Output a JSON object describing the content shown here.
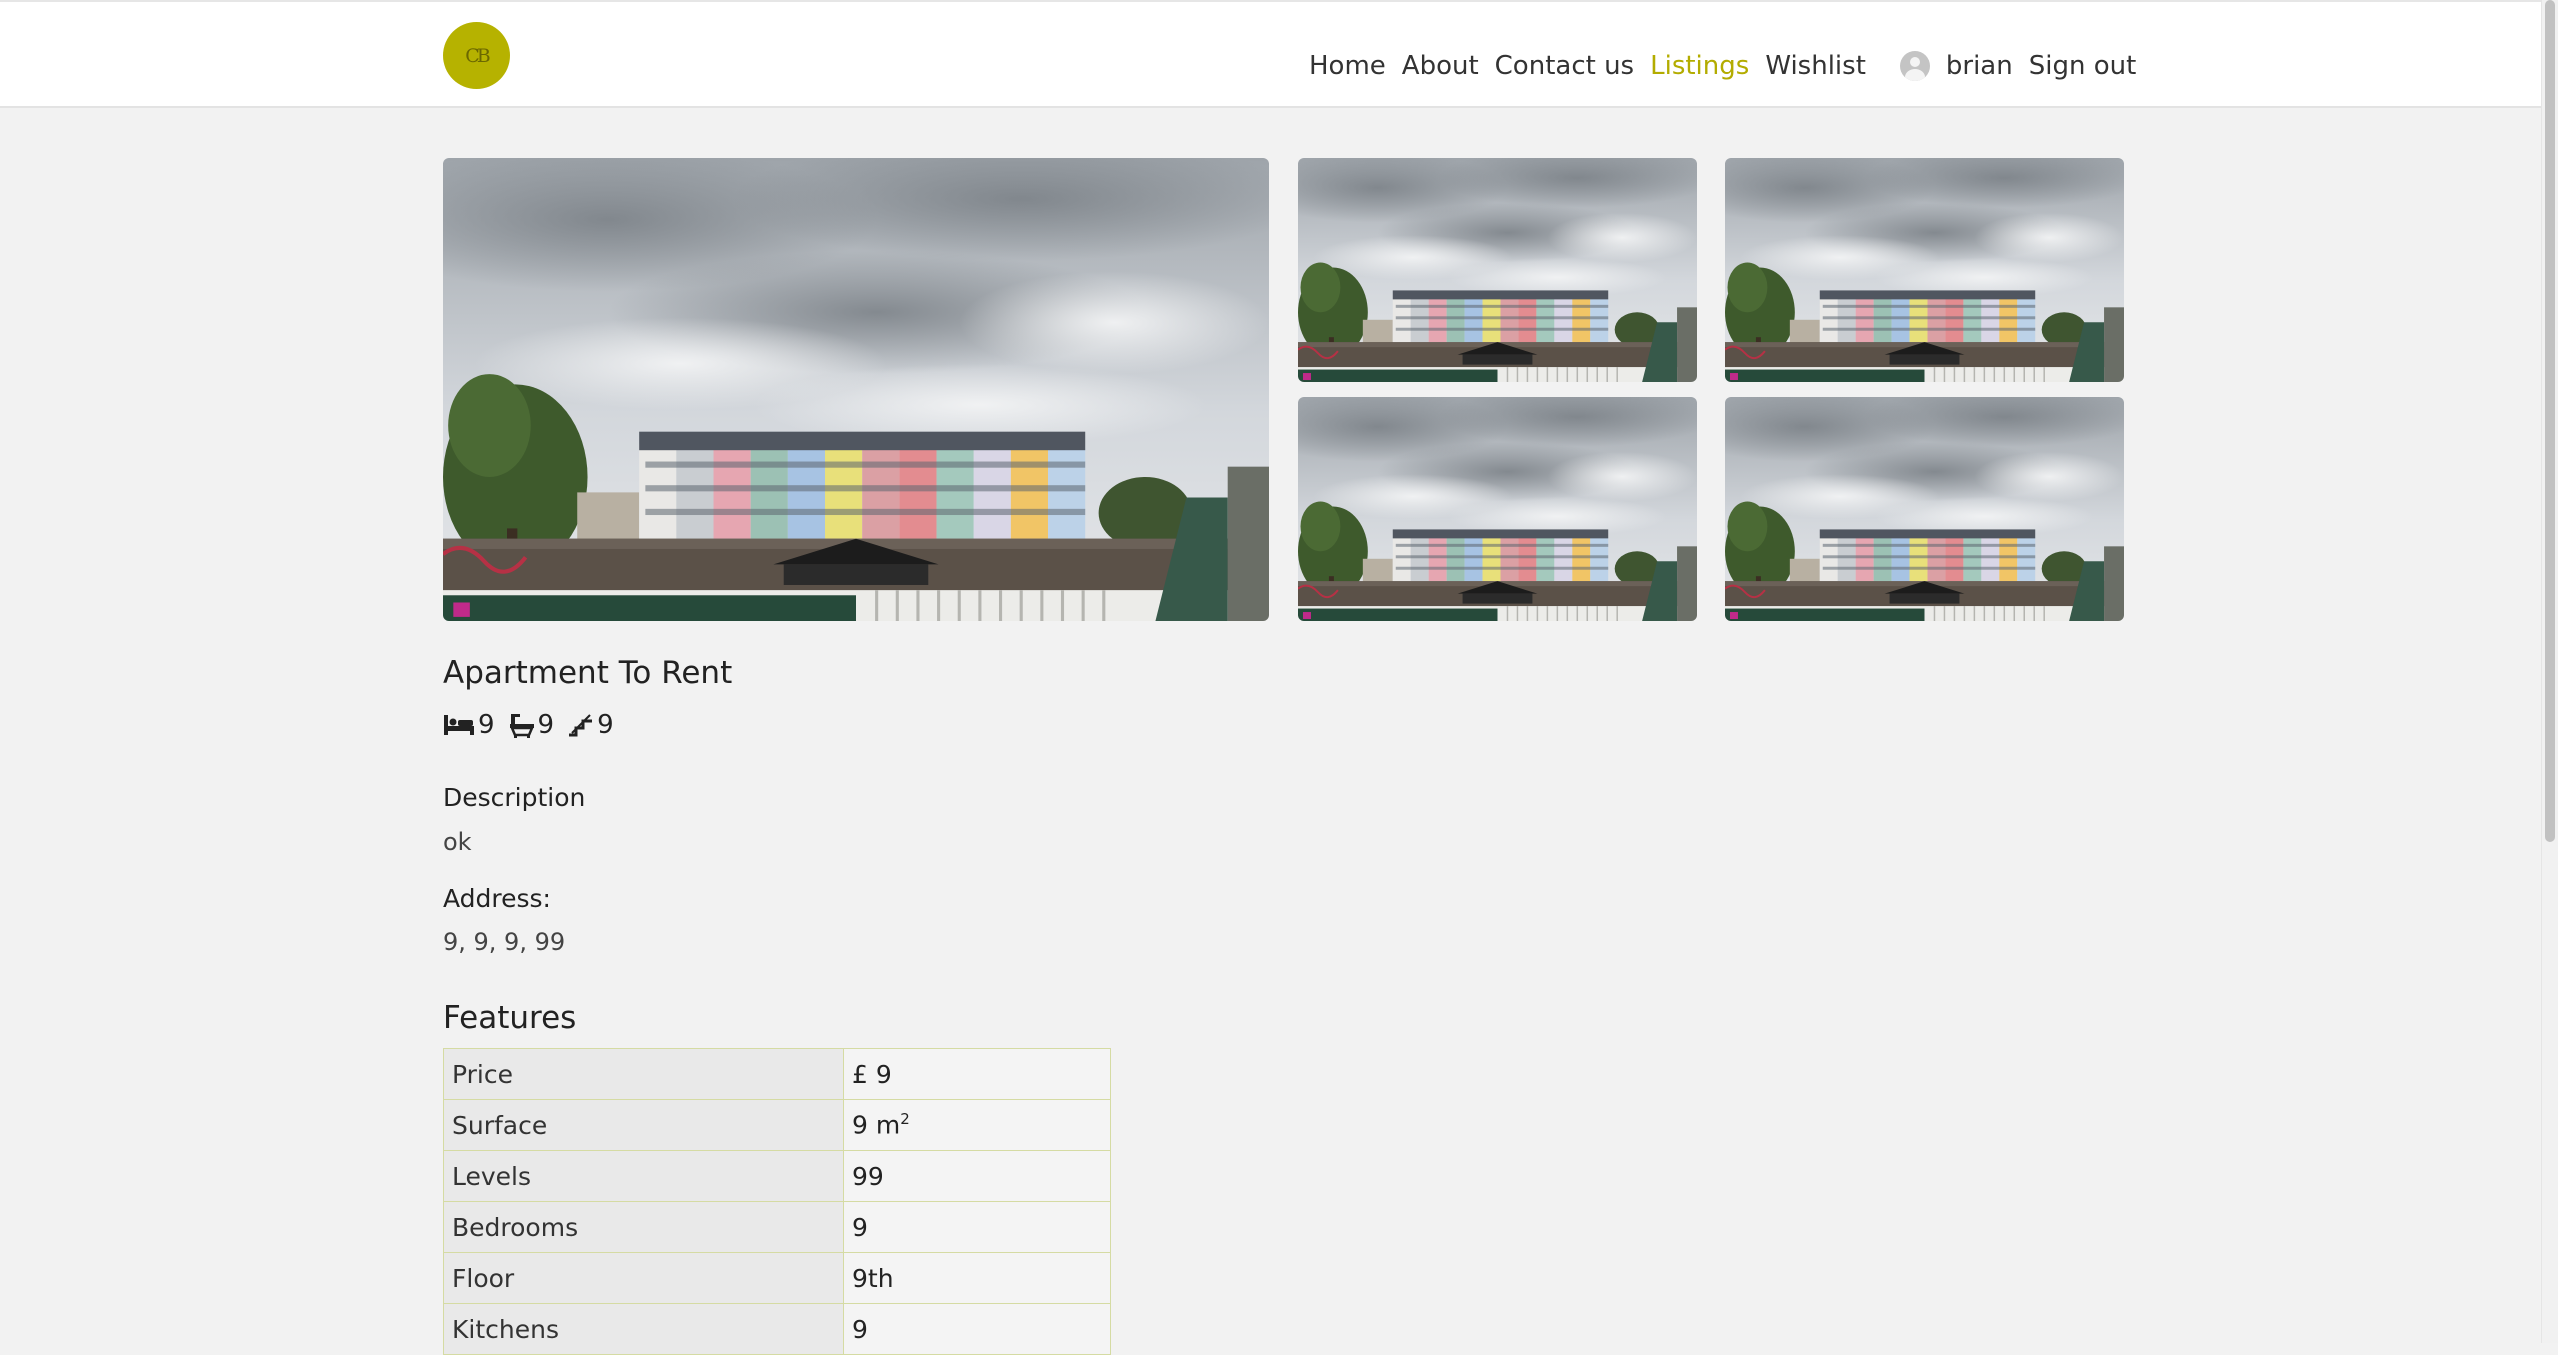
{
  "header": {
    "logo_text": "CB",
    "nav": [
      {
        "label": "Home",
        "active": false
      },
      {
        "label": "About",
        "active": false
      },
      {
        "label": "Contact us",
        "active": false
      },
      {
        "label": "Listings",
        "active": true
      },
      {
        "label": "Wishlist",
        "active": false
      }
    ],
    "username": "brian",
    "sign_out": "Sign out",
    "accent_color": "#b6b200"
  },
  "gallery": {
    "photo_count": 5,
    "subject": "row of colourful terraced houses under a cloudy sky"
  },
  "listing": {
    "title": "Apartment To Rent",
    "stats": {
      "bedrooms": "9",
      "bathrooms": "9",
      "levels": "9"
    },
    "description_label": "Description",
    "description": "ok",
    "address_label": "Address:",
    "address": "9, 9, 9, 99"
  },
  "features": {
    "title": "Features",
    "rows": [
      {
        "key": "Price",
        "value": "£ 9"
      },
      {
        "key": "Surface",
        "value": "9 m",
        "sup": "2"
      },
      {
        "key": "Levels",
        "value": "99"
      },
      {
        "key": "Bedrooms",
        "value": "9"
      },
      {
        "key": "Floor",
        "value": "9th"
      },
      {
        "key": "Kitchens",
        "value": "9"
      }
    ]
  }
}
